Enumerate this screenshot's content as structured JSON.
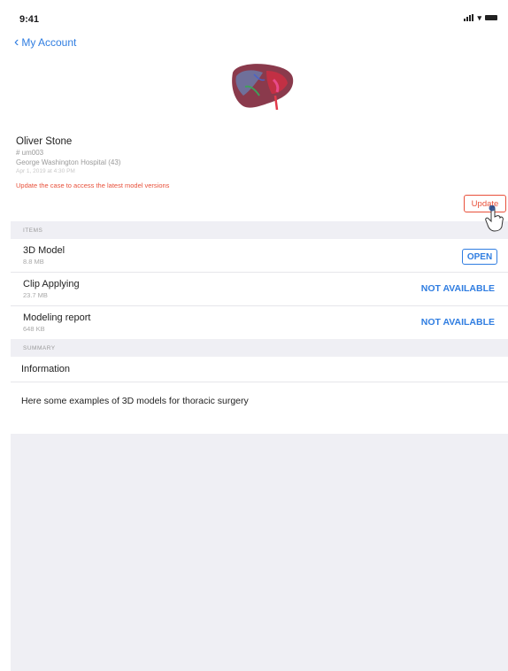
{
  "status_bar": {
    "time": "9:41"
  },
  "nav": {
    "back_label": "My Account"
  },
  "patient": {
    "name": "Oliver Stone",
    "id": "# um003",
    "hospital": "George Washington Hospital (43)",
    "date": "Apr 1, 2019 at 4:30 PM",
    "warning": "Update the case to access the latest model versions",
    "update_label": "Update"
  },
  "sections": {
    "items_header": "ITEMS",
    "summary_header": "SUMMARY"
  },
  "items": [
    {
      "name": "3D Model",
      "size": "8.8 MB",
      "action": "OPEN"
    },
    {
      "name": "Clip Applying",
      "size": "23.7 MB",
      "action": "NOT AVAILABLE"
    },
    {
      "name": "Modeling report",
      "size": "648 KB",
      "action": "NOT AVAILABLE"
    }
  ],
  "summary": {
    "title": "Information",
    "body": "Here some examples of 3D models for thoracic surgery"
  },
  "colors": {
    "accent": "#2f7de1",
    "warning": "#e8503a",
    "group_bg": "#efeff4"
  }
}
